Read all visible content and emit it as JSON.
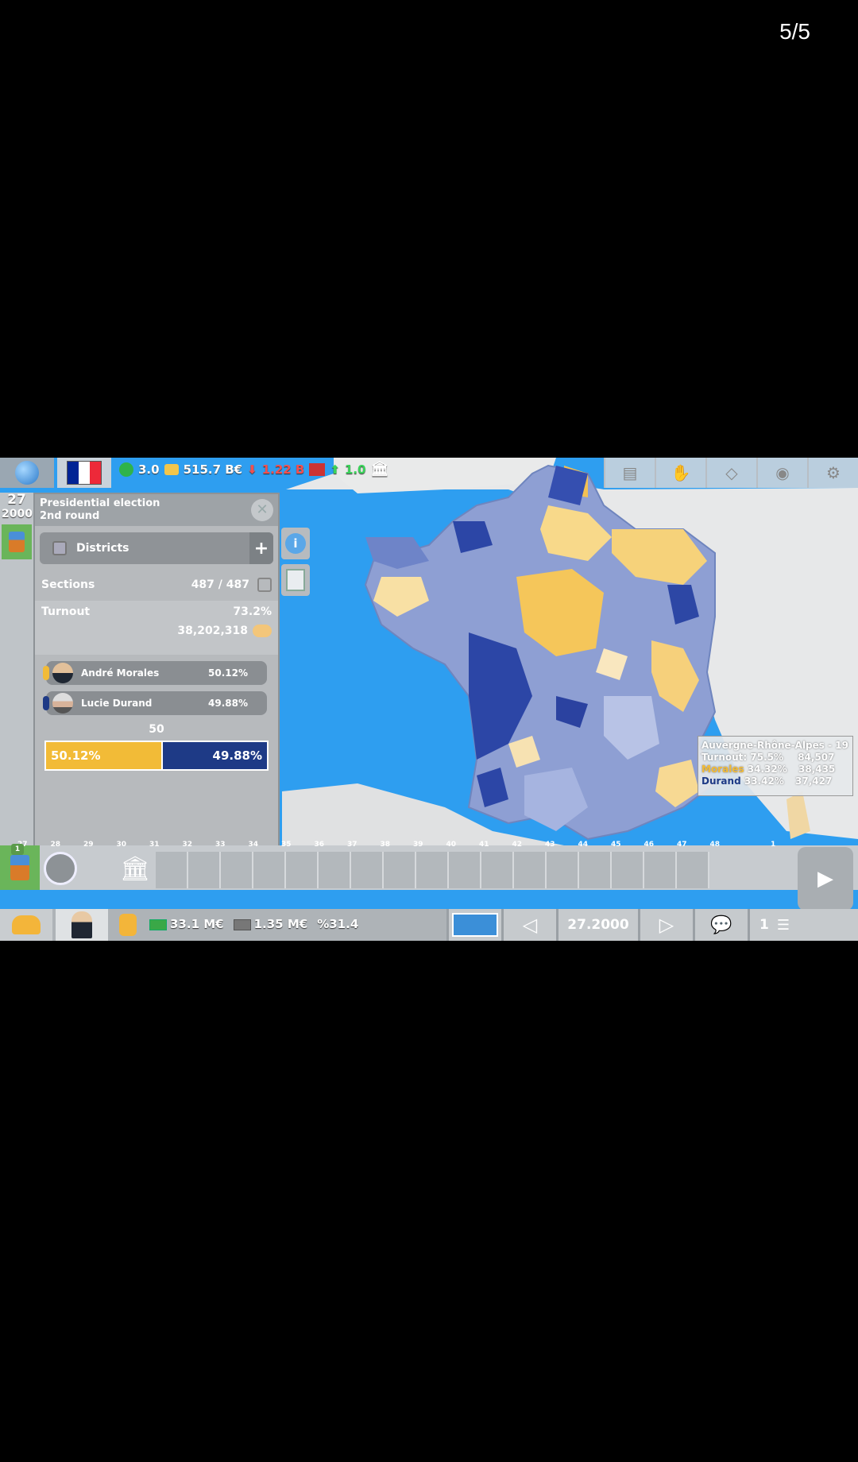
{
  "screen": {
    "counter": "5/5"
  },
  "topbar": {
    "happiness": "3.0",
    "budget": "515.7 B€",
    "debt_change": "1.22 B",
    "industry_change": "1.0",
    "flag_colors": [
      "#002395",
      "#ffffff",
      "#ed2939"
    ]
  },
  "date": {
    "day": "27",
    "year": "2000"
  },
  "election_panel": {
    "title_line1": "Presidential election",
    "title_line2": "2nd round",
    "districts_label": "Districts",
    "plus_label": "+",
    "sections_label": "Sections",
    "sections_value": "487 / 487",
    "turnout_label": "Turnout",
    "turnout_pct": "73.2%",
    "turnout_votes": "38,202,318",
    "candidates": [
      {
        "name": "André Morales",
        "pct": "50.12%",
        "color": "#f2bb37"
      },
      {
        "name": "Lucie Durand",
        "pct": "49.88%",
        "color": "#1e3a86"
      }
    ],
    "half_mark": "50",
    "bar_left": "50.12%",
    "bar_right": "49.88%",
    "bar_left_fraction": 0.5012
  },
  "side_buttons": {
    "info": "i"
  },
  "tooltip": {
    "region": "Auvergne-Rhône-Alpes - 19",
    "turnout": "Turnout: 75.5%",
    "turnout_votes": "84,507",
    "morales_label": "Morales",
    "morales_pct": "34.32%",
    "morales_votes": "38,435",
    "durand_label": "Durand",
    "durand_pct": "33.42%",
    "durand_votes": "37,427"
  },
  "timeline": {
    "marker_top": "1",
    "numbers": [
      "27",
      "28",
      "29",
      "30",
      "31",
      "32",
      "33",
      "34",
      "35",
      "36",
      "37",
      "38",
      "39",
      "40",
      "41",
      "42",
      "43",
      "44",
      "45",
      "46",
      "47",
      "48",
      "1"
    ]
  },
  "bottombar": {
    "cash1": "33.1 M€",
    "cash2": "1.35 M€",
    "percent_symbol": "%",
    "percent_value": "31.4",
    "date_display": "27.2000",
    "page": "1"
  },
  "icons": [
    "globe-icon",
    "smile-icon",
    "coins-icon",
    "factory-icon",
    "bank-icon",
    "close-icon",
    "info-icon",
    "document-search-icon",
    "play-icon",
    "people-icon",
    "president-icon",
    "hand-icon",
    "cash-icon",
    "world-map-icon",
    "arrow-left-icon",
    "arrow-right-icon",
    "chat-icon",
    "list-icon"
  ]
}
